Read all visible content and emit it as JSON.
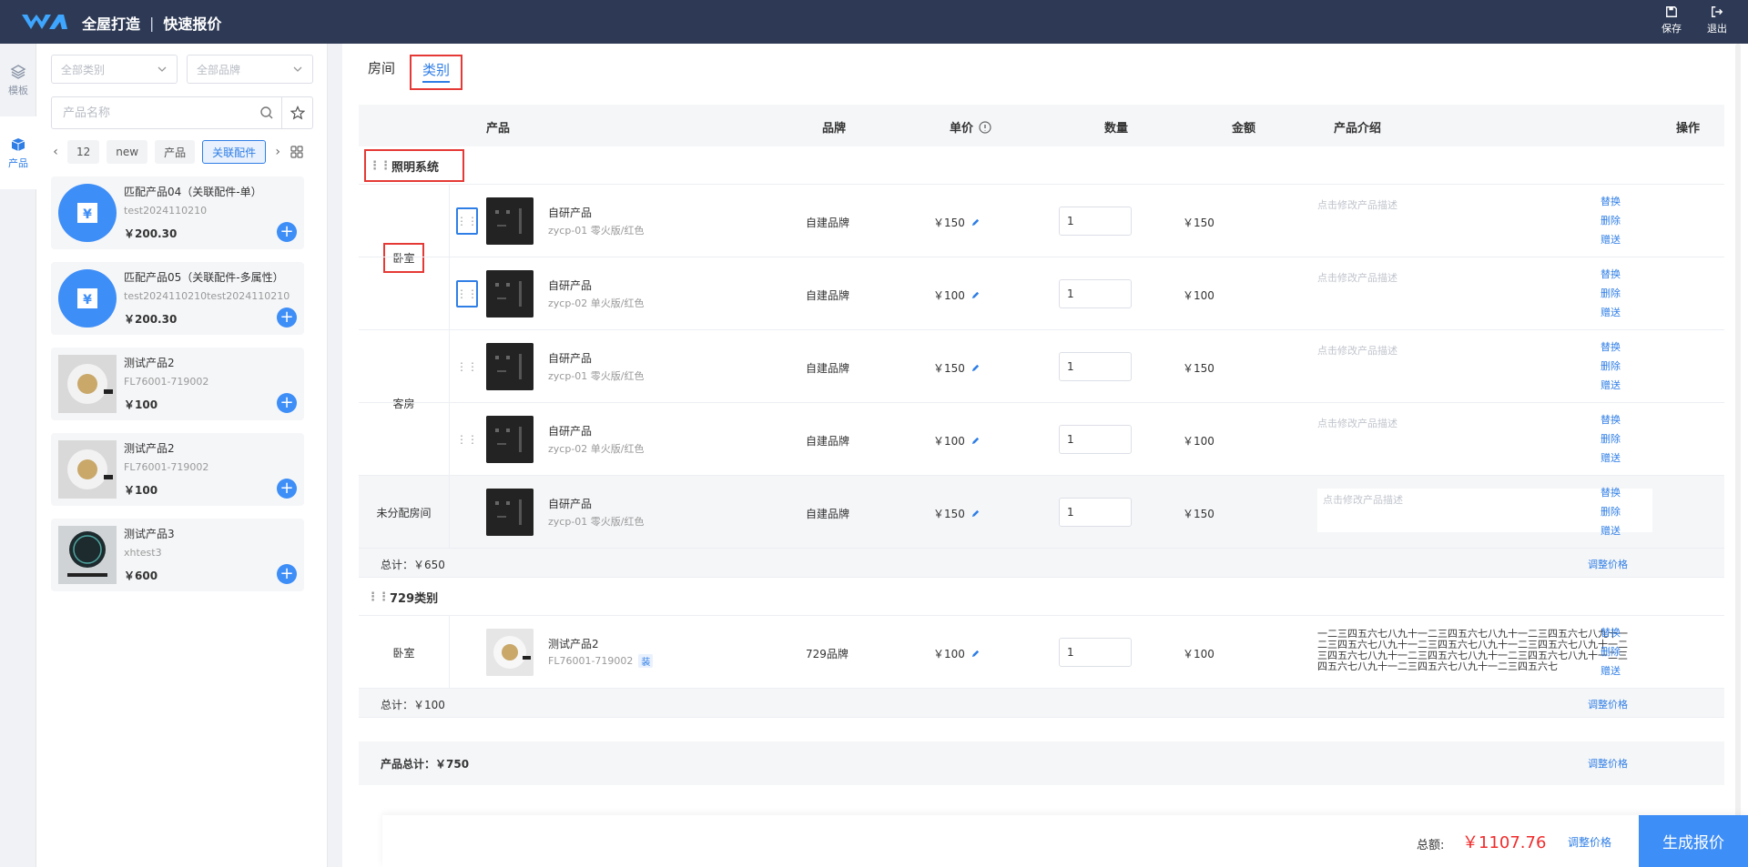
{
  "header": {
    "brand": "全屋打造",
    "separator": "|",
    "page_title": "快速报价",
    "save_label": "保存",
    "exit_label": "退出"
  },
  "rail": {
    "template_label": "模板",
    "product_label": "产品"
  },
  "sidebar": {
    "category_placeholder": "全部类别",
    "brand_placeholder": "全部品牌",
    "search_placeholder": "产品名称",
    "chips": [
      "12",
      "new",
      "产品",
      "关联配件"
    ],
    "products": [
      {
        "name": "匹配产品04（关联配件-单）",
        "code": "test2024110210",
        "price": "￥200.30",
        "icon": "yuan-icon"
      },
      {
        "name": "匹配产品05（关联配件-多属性）",
        "code": "test2024110210test2024110210",
        "price": "￥200.30",
        "icon": "yuan-icon"
      },
      {
        "name": "测试产品2",
        "code": "FL76001-719002",
        "price": "￥100",
        "icon": "downlight-image"
      },
      {
        "name": "测试产品2",
        "code": "FL76001-719002",
        "price": "￥100",
        "icon": "downlight-image"
      },
      {
        "name": "测试产品3",
        "code": "xhtest3",
        "price": "￥600",
        "icon": "thermostat-image"
      }
    ]
  },
  "tabs": {
    "room": "房间",
    "category": "类别"
  },
  "table": {
    "headers": {
      "product": "产品",
      "brand": "品牌",
      "unit_price": "单价",
      "quantity": "数量",
      "amount": "金额",
      "intro": "产品介绍",
      "ops": "操作"
    },
    "ops": {
      "replace": "替换",
      "delete": "删除",
      "gift": "赠送"
    },
    "desc_placeholder": "点击修改产品描述",
    "adjust_price": "调整价格",
    "groups": [
      {
        "title": "照明系统",
        "subtotal": "总计：￥650",
        "rooms": [
          {
            "room": "卧室",
            "items": [
              {
                "name": "自研产品",
                "spec": "zycp-01 零火版/红色",
                "brand": "自建品牌",
                "unit": "￥150",
                "qty": "1",
                "amount": "￥150"
              },
              {
                "name": "自研产品",
                "spec": "zycp-02 单火版/红色",
                "brand": "自建品牌",
                "unit": "￥100",
                "qty": "1",
                "amount": "￥100"
              }
            ]
          },
          {
            "room": "客房",
            "items": [
              {
                "name": "自研产品",
                "spec": "zycp-01 零火版/红色",
                "brand": "自建品牌",
                "unit": "￥150",
                "qty": "1",
                "amount": "￥150"
              },
              {
                "name": "自研产品",
                "spec": "zycp-02 单火版/红色",
                "brand": "自建品牌",
                "unit": "￥100",
                "qty": "1",
                "amount": "￥100"
              }
            ]
          },
          {
            "room": "未分配房间",
            "items": [
              {
                "name": "自研产品",
                "spec": "zycp-01 零火版/红色",
                "brand": "自建品牌",
                "unit": "￥150",
                "qty": "1",
                "amount": "￥150"
              }
            ]
          }
        ]
      },
      {
        "title": "729类别",
        "subtotal": "总计：￥100",
        "rooms": [
          {
            "room": "卧室",
            "items": [
              {
                "name": "测试产品2",
                "spec": "FL76001-719002",
                "tag": "装",
                "brand": "729品牌",
                "unit": "￥100",
                "qty": "1",
                "amount": "￥100",
                "desc": "一二三四五六七八九十一二三四五六七八九十一二三四五六七八九十一二三四五六七八九十一二三四五六七八九十一二三四五六七八九十一二三四五六七八九十一二三四五六七八九十一二三四五六七八九十一二三四五六七八九十一二三四五六七八九十一二三四五六七"
              }
            ]
          }
        ]
      }
    ],
    "grand_total": "产品总计：￥750"
  },
  "footer": {
    "total_label": "总额:",
    "total_value": "￥1107.76",
    "adjust": "调整价格",
    "generate": "生成报价"
  },
  "colors": {
    "header_bg": "#2e3a55",
    "accent": "#3e8ef7",
    "price_red": "#f02b2b",
    "highlight_red": "#e53935"
  }
}
